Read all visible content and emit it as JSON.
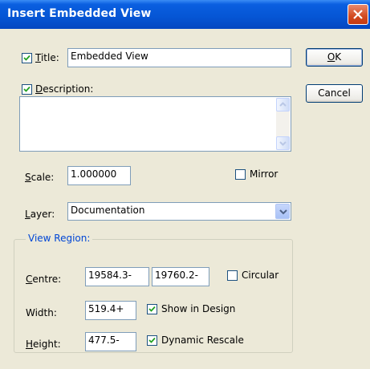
{
  "window": {
    "title": "Insert Embedded View"
  },
  "title_field": {
    "label": "Title:",
    "checked": true,
    "value": "Embedded View"
  },
  "description": {
    "label": "Description:",
    "checked": true,
    "value": ""
  },
  "buttons": {
    "ok": "OK",
    "cancel": "Cancel"
  },
  "scale": {
    "label": "Scale:",
    "value": "1.000000"
  },
  "mirror": {
    "label": "Mirror",
    "checked": false
  },
  "layer": {
    "label": "Layer:",
    "value": "Documentation"
  },
  "view_region": {
    "title": "View Region:",
    "centre": {
      "label": "Centre:",
      "x": "19584.3-",
      "y": "19760.2-"
    },
    "circular": {
      "label": "Circular",
      "checked": false
    },
    "width": {
      "label": "Width:",
      "value": "519.4+"
    },
    "show_in_design": {
      "label": "Show in Design",
      "checked": true
    },
    "height": {
      "label": "Height:",
      "value": "477.5-"
    },
    "dynamic_rescale": {
      "label": "Dynamic Rescale",
      "checked": true
    }
  }
}
